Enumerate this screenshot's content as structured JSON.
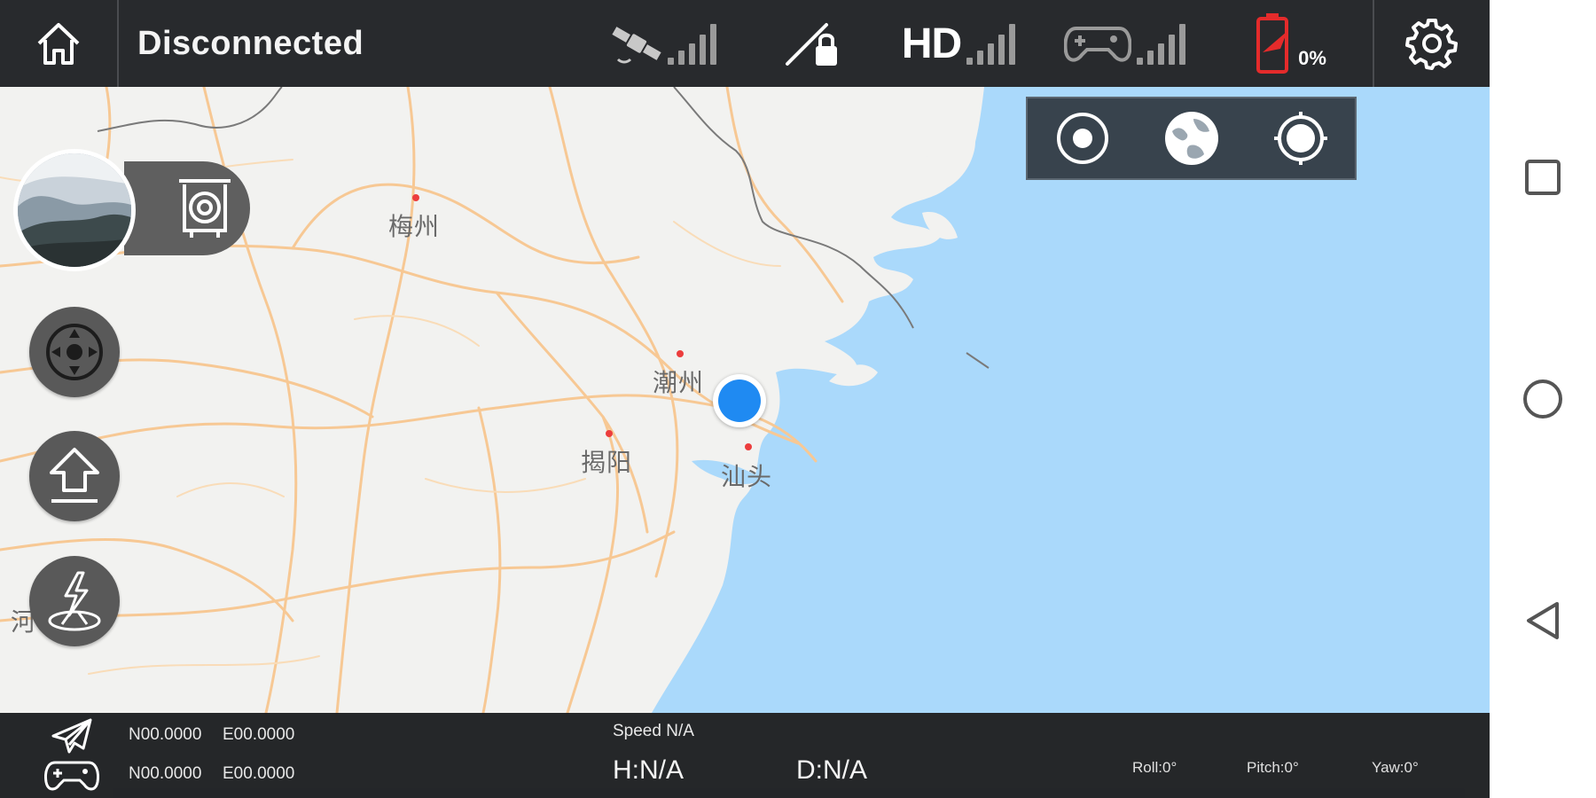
{
  "top_bar": {
    "home_icon": "home-icon",
    "status": "Disconnected",
    "satellite_icon": "satellite-icon",
    "link_lock_icon": "link-lock-icon",
    "hd_label": "HD",
    "controller_icon": "gamepad-icon",
    "battery_icon": "battery-icon",
    "battery_percent": "0%",
    "settings_icon": "gear-icon"
  },
  "map": {
    "cities": [
      {
        "name": "梅州"
      },
      {
        "name": "潮州"
      },
      {
        "name": "揭阳"
      },
      {
        "name": "汕头"
      },
      {
        "name": "河"
      }
    ]
  },
  "map_mode_panel": {
    "buttons": [
      {
        "icon": "locate-dot-icon"
      },
      {
        "icon": "globe-icon"
      },
      {
        "icon": "crosshair-icon"
      }
    ]
  },
  "left_controls": {
    "camera_thumb": "camera-preview",
    "camera_switch_icon": "camera-switch-icon",
    "buttons": [
      {
        "icon": "joystick-icon"
      },
      {
        "icon": "takeoff-icon"
      },
      {
        "icon": "return-home-icon"
      }
    ]
  },
  "bottom_bar": {
    "drone_icon": "plane-icon",
    "controller_icon": "gamepad-icon",
    "drone_lat": "N00.0000",
    "drone_lon": "E00.0000",
    "remote_lat": "N00.0000",
    "remote_lon": "E00.0000",
    "speed": "Speed N/A",
    "height": "H:N/A",
    "distance": "D:N/A",
    "roll": "Roll:0°",
    "pitch": "Pitch:0°",
    "yaw": "Yaw:0°"
  },
  "android_nav": {
    "recents_icon": "square-icon",
    "home_icon": "circle-icon",
    "back_icon": "triangle-back-icon"
  },
  "colors": {
    "sea": "#aad9fb",
    "land": "#f2f2f0",
    "roads": "#f8c890",
    "battery_alert": "#e42b2b",
    "location_dot": "#1f8af2"
  }
}
